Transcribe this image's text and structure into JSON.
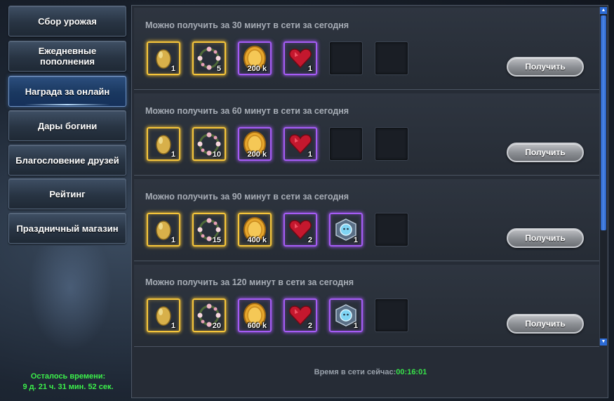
{
  "sidebar": {
    "items": [
      {
        "label": "Сбор урожая"
      },
      {
        "label": "Ежедневные пополнения"
      },
      {
        "label": "Награда за онлайн"
      },
      {
        "label": "Дары богини"
      },
      {
        "label": "Благословение друзей"
      },
      {
        "label": "Рейтинг"
      },
      {
        "label": "Праздничный магазин"
      }
    ],
    "active_index": 2,
    "time_left_label": "Осталось времени:",
    "time_left_value": "9 д. 21 ч. 31 мин. 52 сек."
  },
  "rewards": [
    {
      "title": "Можно получить за 30 минут в сети за сегодня",
      "button": "Получить",
      "items": [
        {
          "icon": "egg-icon",
          "qty": "1",
          "rarity": "gold"
        },
        {
          "icon": "flower-wreath-icon",
          "qty": "5",
          "rarity": "gold"
        },
        {
          "icon": "gold-coin-icon",
          "qty": "200 k",
          "rarity": "purple"
        },
        {
          "icon": "ruby-heart-icon",
          "qty": "1",
          "rarity": "purple"
        }
      ],
      "empty_slots": 2
    },
    {
      "title": "Можно получить за 60 минут в сети за сегодня",
      "button": "Получить",
      "items": [
        {
          "icon": "egg-icon",
          "qty": "1",
          "rarity": "gold"
        },
        {
          "icon": "flower-wreath-icon",
          "qty": "10",
          "rarity": "gold"
        },
        {
          "icon": "gold-coin-icon",
          "qty": "200 k",
          "rarity": "purple"
        },
        {
          "icon": "ruby-heart-icon",
          "qty": "1",
          "rarity": "purple"
        }
      ],
      "empty_slots": 2
    },
    {
      "title": "Можно получить за 90 минут в сети за сегодня",
      "button": "Получить",
      "items": [
        {
          "icon": "egg-icon",
          "qty": "1",
          "rarity": "gold"
        },
        {
          "icon": "flower-wreath-icon",
          "qty": "15",
          "rarity": "gold"
        },
        {
          "icon": "gold-coin-icon",
          "qty": "400 k",
          "rarity": "gold"
        },
        {
          "icon": "ruby-heart-icon",
          "qty": "2",
          "rarity": "purple"
        },
        {
          "icon": "crystal-emblem-icon",
          "qty": "1",
          "rarity": "purple"
        }
      ],
      "empty_slots": 1
    },
    {
      "title": "Можно получить за 120 минут в сети за сегодня",
      "button": "Получить",
      "items": [
        {
          "icon": "egg-icon",
          "qty": "1",
          "rarity": "gold"
        },
        {
          "icon": "flower-wreath-icon",
          "qty": "20",
          "rarity": "gold"
        },
        {
          "icon": "gold-coin-icon",
          "qty": "600 k",
          "rarity": "purple"
        },
        {
          "icon": "ruby-heart-icon",
          "qty": "2",
          "rarity": "purple"
        },
        {
          "icon": "crystal-emblem-icon",
          "qty": "1",
          "rarity": "purple"
        }
      ],
      "empty_slots": 1
    }
  ],
  "footer": {
    "online_label": "Время в сети сейчас:",
    "online_value": "00:16:01"
  },
  "colors": {
    "accent_green": "#3cf04b",
    "gold_frame": "#f5c53b",
    "purple_frame": "#a55cf5",
    "scroll_blue": "#2c6bd6"
  }
}
